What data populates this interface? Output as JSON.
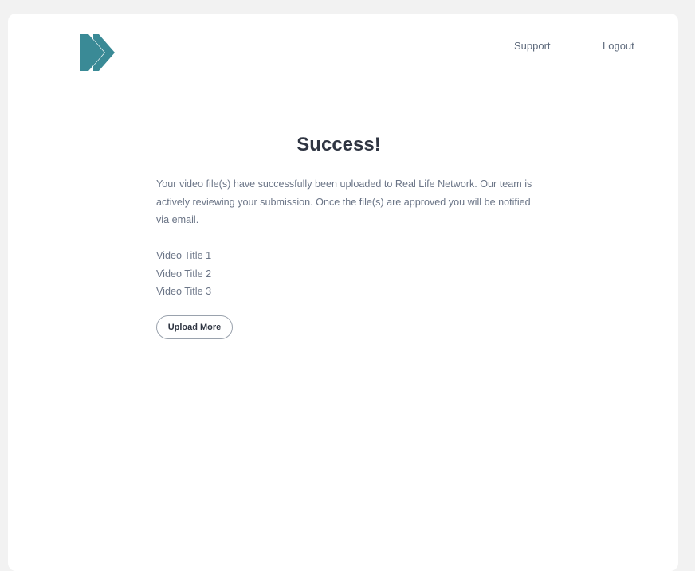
{
  "header": {
    "logo_icon": "double-chevron-right-icon",
    "brand_color": "#3a8a96",
    "nav": {
      "support_label": "Support",
      "logout_label": "Logout"
    }
  },
  "main": {
    "title": "Success!",
    "message": "Your video file(s) have successfully been uploaded to Real Life Network. Our team is actively reviewing your submission.  Once the file(s) are approved you will be notified via email.",
    "videos": [
      "Video Title 1",
      "Video Title 2",
      "Video Title 3"
    ],
    "upload_more_label": "Upload More"
  }
}
